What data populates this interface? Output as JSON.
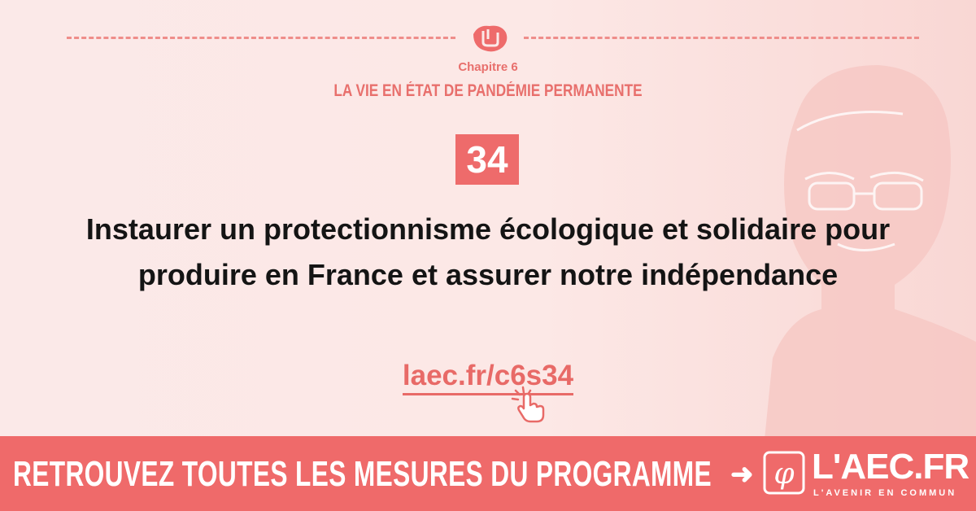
{
  "header": {
    "chapter_label": "Chapitre 6",
    "chapter_title": "LA VIE EN ÉTAT DE PANDÉMIE PERMANENTE",
    "icon": "handshake-icon"
  },
  "measure": {
    "number": "34",
    "title": "Instaurer un protectionnisme écologique et solidaire pour produire en France et assurer notre indépendance",
    "link": "laec.fr/c6s34",
    "link_icon": "pointer-hand-icon"
  },
  "banner": {
    "text": "RETROUVEZ TOUTES LES MESURES DU PROGRAMME",
    "arrow_icon": "arrow-right-icon",
    "logo_text": "L'AEC.FR",
    "logo_tagline": "L'AVENIR EN COMMUN"
  },
  "colors": {
    "accent": "#ee6b6b",
    "background": "#fbe9e8",
    "text": "#141414"
  }
}
